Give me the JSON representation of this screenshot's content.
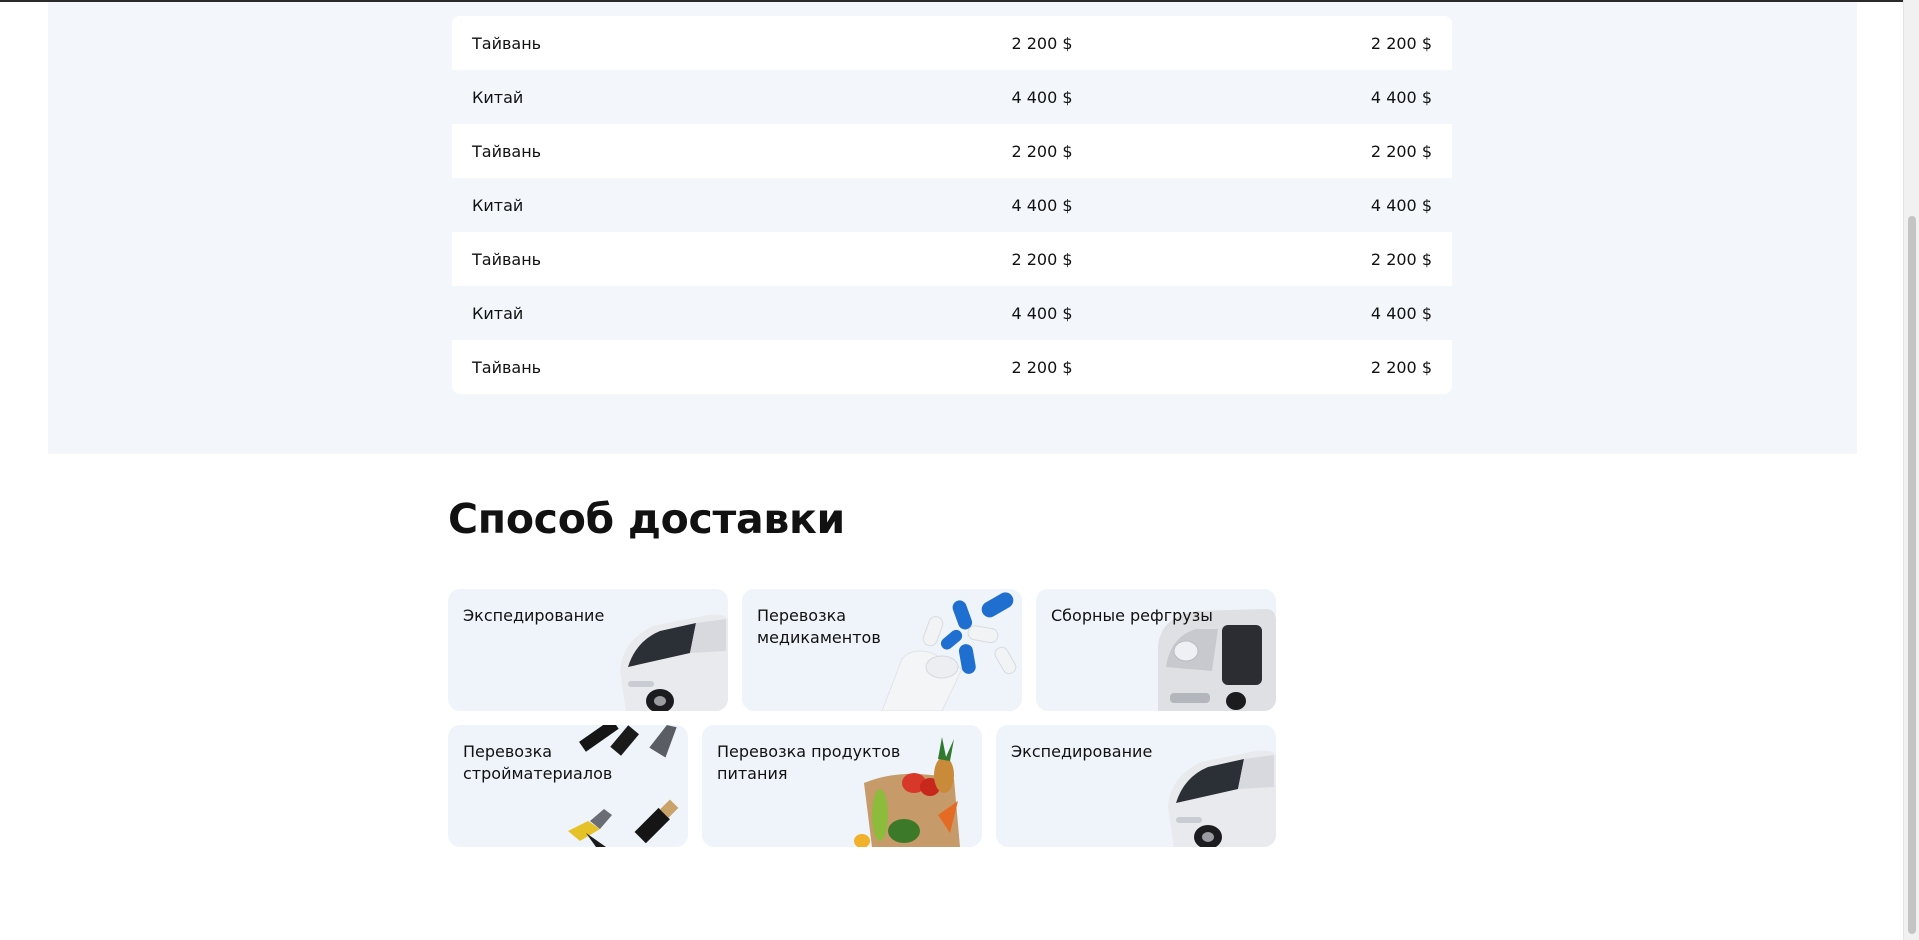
{
  "price_table": {
    "rows": [
      {
        "country": "Тайвань",
        "price_a": "2 200 $",
        "price_b": "2 200 $"
      },
      {
        "country": "Китай",
        "price_a": "4 400 $",
        "price_b": "4 400 $"
      },
      {
        "country": "Тайвань",
        "price_a": "2 200 $",
        "price_b": "2 200 $"
      },
      {
        "country": "Китай",
        "price_a": "4 400 $",
        "price_b": "4 400 $"
      },
      {
        "country": "Тайвань",
        "price_a": "2 200 $",
        "price_b": "2 200 $"
      },
      {
        "country": "Китай",
        "price_a": "4 400 $",
        "price_b": "4 400 $"
      },
      {
        "country": "Тайвань",
        "price_a": "2 200 $",
        "price_b": "2 200 $"
      }
    ]
  },
  "delivery": {
    "title": "Способ доставки",
    "cards": [
      {
        "label": "Экспедирование",
        "icon": "truck-icon"
      },
      {
        "label": "Перевозка медикаментов",
        "icon": "pills-icon"
      },
      {
        "label": "Сборные рефгрузы",
        "icon": "truck-cab-icon"
      },
      {
        "label": "Перевозка стройматериалов",
        "icon": "tools-icon"
      },
      {
        "label": "Перевозка продуктов питания",
        "icon": "groceries-icon"
      },
      {
        "label": "Экспедирование",
        "icon": "truck-icon"
      }
    ]
  },
  "colors": {
    "section_bg": "#f3f7fb",
    "card_bg": "#eef4fa",
    "pill_blue": "#1f6fd1"
  }
}
